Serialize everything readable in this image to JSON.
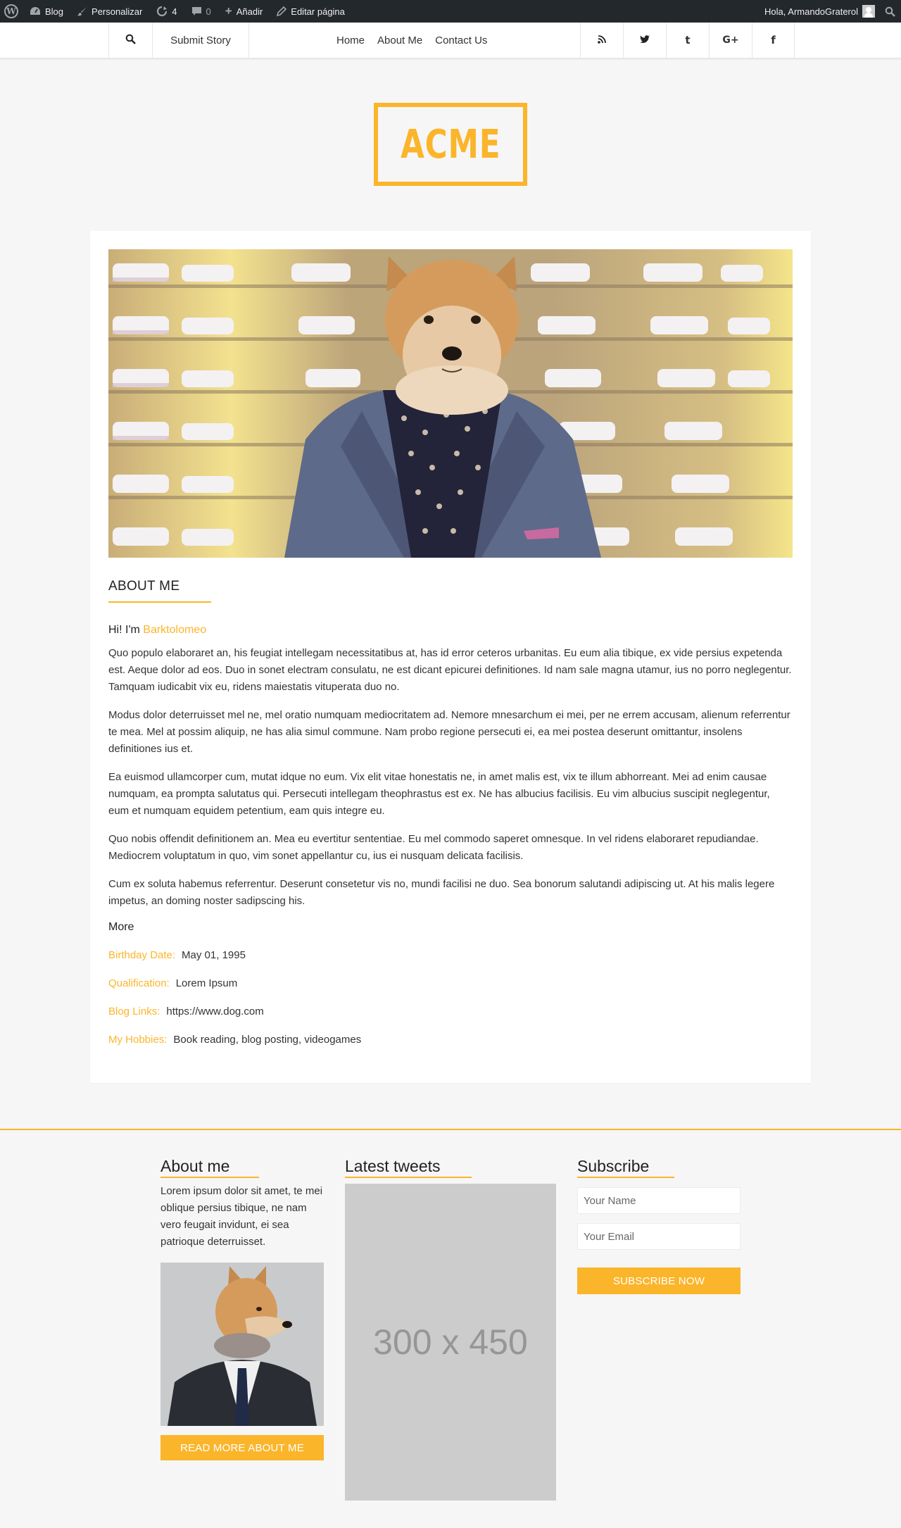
{
  "admin_bar": {
    "blog": "Blog",
    "customize": "Personalizar",
    "updates_count": "4",
    "comments_count": "0",
    "add_new": "Añadir",
    "edit_page": "Editar página",
    "greeting": "Hola, ArmandoGraterol",
    "icons": [
      "wordpress-logo-icon",
      "dashboard-icon",
      "brush-icon",
      "updates-icon",
      "comment-icon",
      "plus-icon",
      "pencil-icon",
      "avatar-icon",
      "search-icon"
    ]
  },
  "nav": {
    "submit_story": "Submit Story",
    "menu": [
      "Home",
      "About Me",
      "Contact Us"
    ],
    "social_icons": [
      "rss-icon",
      "twitter-icon",
      "tumblr-icon",
      "google-plus-icon",
      "facebook-icon"
    ],
    "social_glyphs": [
      "∷",
      "❦",
      "t",
      "G+",
      "f"
    ]
  },
  "logo": {
    "text": "ACME",
    "color": "#fbb52b"
  },
  "about": {
    "section_title": "ABOUT ME",
    "greeting_prefix": "Hi! I'm ",
    "name": "Barktolomeo",
    "paragraphs": [
      "Quo populo elaboraret an, his feugiat intellegam necessitatibus at, has id error ceteros urbanitas. Eu eum alia tibique, ex vide persius expetenda est. Aeque dolor ad eos. Duo in sonet electram consulatu, ne est dicant epicurei definitiones. Id nam sale magna utamur, ius no porro neglegentur. Tamquam iudicabit vix eu, ridens maiestatis vituperata duo no.",
      "Modus dolor deterruisset mel ne, mel oratio numquam mediocritatem ad. Nemore mnesarchum ei mei, per ne errem accusam, alienum referrentur te mea. Mel at possim aliquip, ne has alia simul commune. Nam probo regione persecuti ei, ea mei postea deserunt omittantur, insolens definitiones ius et.",
      "Ea euismod ullamcorper cum, mutat idque no eum. Vix elit vitae honestatis ne, in amet malis est, vix te illum abhorreant. Mei ad enim causae numquam, ea prompta salutatus qui. Persecuti intellegam theophrastus est ex. Ne has albucius facilisis. Eu vim albucius suscipit neglegentur, eum et numquam equidem petentium, eam quis integre eu.",
      "Quo nobis offendit definitionem an. Mea eu evertitur sententiae. Eu mel commodo saperet omnesque. In vel ridens elaboraret repudiandae. Mediocrem voluptatum in quo, vim sonet appellantur cu, ius ei nusquam delicata facilisis.",
      "Cum ex soluta habemus referrentur. Deserunt consetetur vis no, mundi facilisi ne duo. Sea bonorum salutandi adipiscing ut. At his malis legere impetus, an doming noster sadipscing his."
    ],
    "more_title": "More",
    "details": [
      {
        "label": "Birthday Date:",
        "value": "May 01, 1995"
      },
      {
        "label": "Qualification:",
        "value": "Lorem Ipsum"
      },
      {
        "label": "Blog Links:",
        "value": "https://www.dog.com"
      },
      {
        "label": "My Hobbies:",
        "value": "Book reading, blog posting, videogames"
      }
    ]
  },
  "footer": {
    "about_title": "About me",
    "about_text": "Lorem ipsum dolor sit amet, te mei oblique persius tibique, ne nam vero feugait invidunt, ei sea patrioque deterruisset.",
    "read_more": "READ MORE ABOUT ME",
    "tweets_title": "Latest tweets",
    "tweets_placeholder": "300 x 450",
    "subscribe_title": "Subscribe",
    "name_placeholder": "Your Name",
    "email_placeholder": "Your Email",
    "subscribe_button": "SUBSCRIBE NOW"
  },
  "colors": {
    "accent": "#fbb52b",
    "admin_bar": "#23282d",
    "page_bg": "#f6f6f6"
  }
}
